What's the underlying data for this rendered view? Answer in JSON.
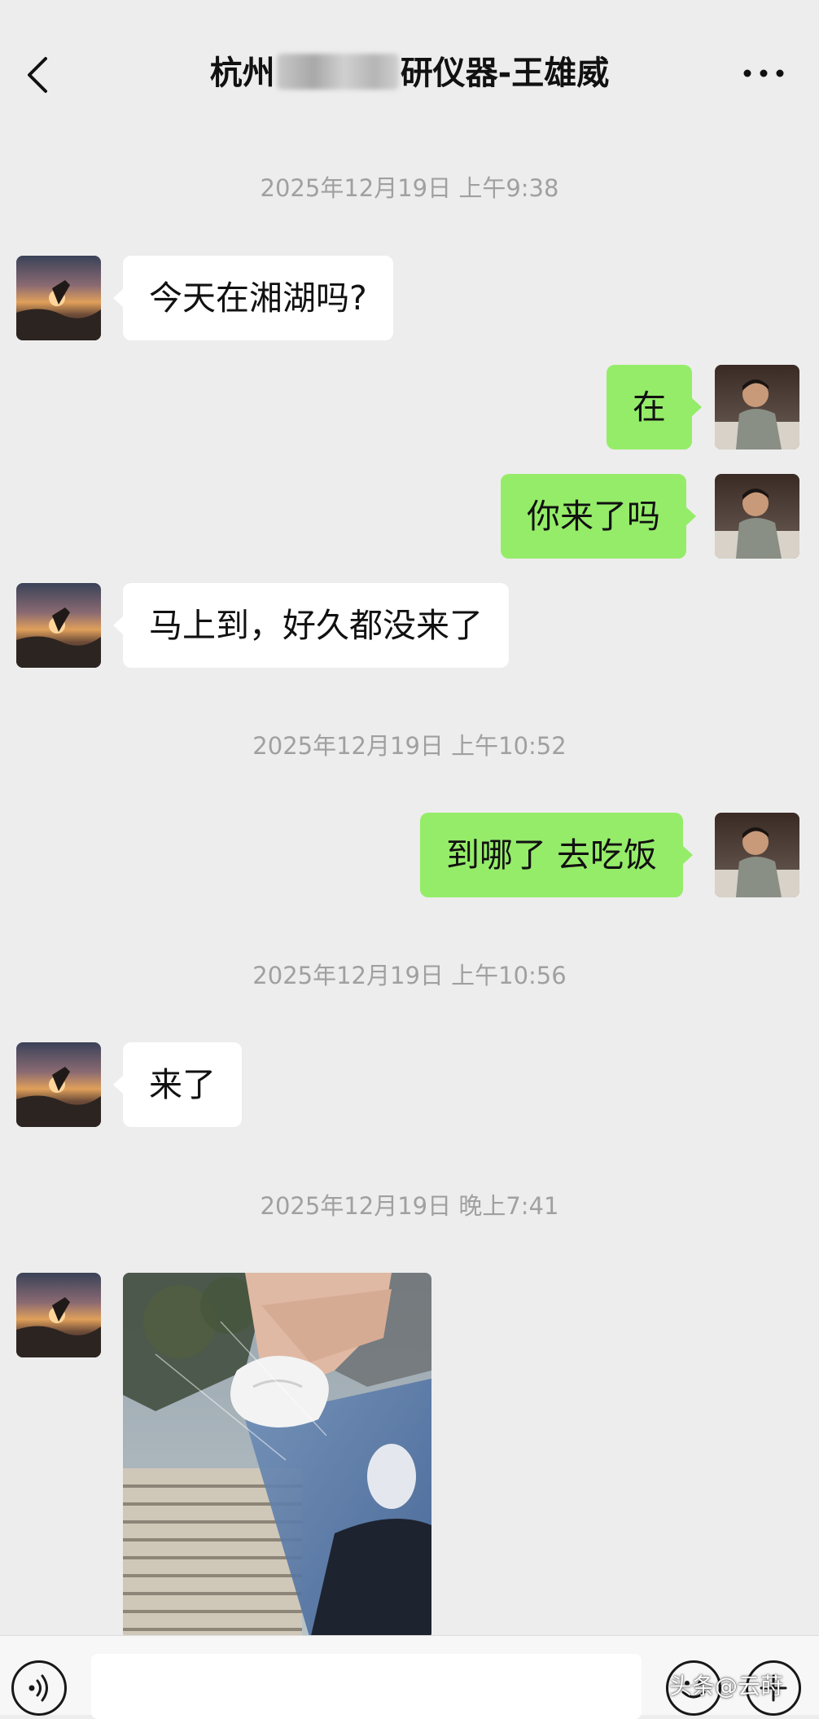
{
  "header": {
    "title_prefix": "杭州",
    "title_suffix": "研仪器-王雄威"
  },
  "colors": {
    "background": "#ededed",
    "bubble_incoming": "#ffffff",
    "bubble_outgoing": "#95ec69",
    "timestamp_text": "#a0a0a0"
  },
  "messages": {
    "ts1": "2025年12月19日 上午9:38",
    "m1": "今天在湘湖吗?",
    "m2": "在",
    "m3": "你来了吗",
    "m4": "马上到，好久都没来了",
    "ts2": "2025年12月19日 上午10:52",
    "m5": "到哪了 去吃饭",
    "ts3": "2025年12月19日 上午10:56",
    "m6": "来了",
    "ts4": "2025年12月19日 晚上7:41"
  },
  "input_bar": {
    "text_value": "",
    "icons": [
      "voice-icon",
      "emoji-icon",
      "plus-icon"
    ]
  },
  "watermark": "头条@云莳"
}
